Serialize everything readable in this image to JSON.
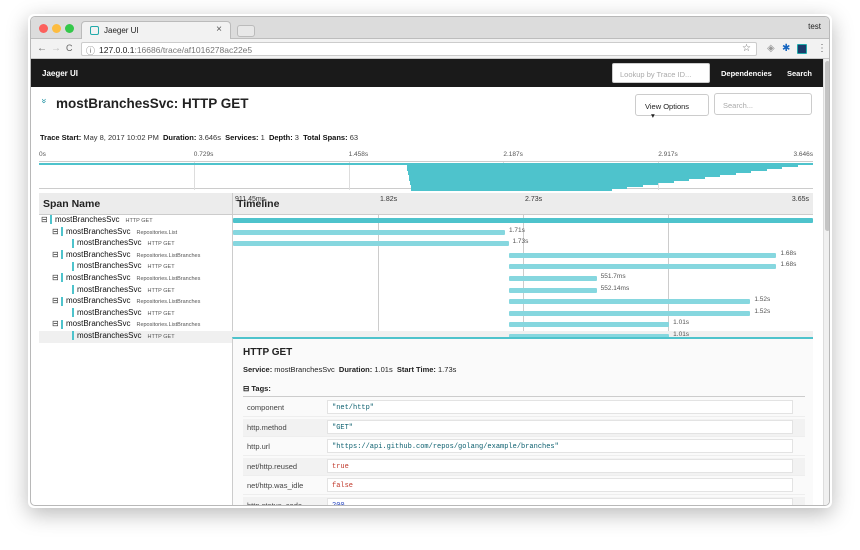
{
  "browser": {
    "tab_title": "Jaeger UI",
    "tab_close": "×",
    "profile": "test",
    "url_host": "127.0.0.1",
    "url_path": ":16686/trace/af1016278ac22e5",
    "nav_back": "←",
    "nav_forward": "→",
    "nav_reload": "C",
    "star": "☆",
    "info": "ⓘ",
    "menu": "⋮"
  },
  "app": {
    "brand": "Jaeger UI",
    "lookup_placeholder": "Lookup by Trace ID...",
    "nav": [
      "Dependencies",
      "Search"
    ]
  },
  "trace": {
    "chevron": "»",
    "title": "mostBranchesSvc: HTTP GET",
    "view_options": "View Options",
    "view_options_caret": "▾",
    "find_placeholder": "Search...",
    "summary": {
      "trace_start_label": "Trace Start:",
      "trace_start": "May 8, 2017 10:02 PM",
      "duration_label": "Duration:",
      "duration": "3.646s",
      "services_label": "Services:",
      "services": "1",
      "depth_label": "Depth:",
      "depth": "3",
      "total_spans_label": "Total Spans:",
      "total_spans": "63"
    },
    "minimap_ticks": [
      "0s",
      "0.729s",
      "1.458s",
      "2.187s",
      "2.917s",
      "3.646s"
    ],
    "header": {
      "span_name": "Span Name",
      "timeline": "Timeline",
      "ticks": [
        "911.45ms",
        "1.82s",
        "2.73s",
        "3.65s"
      ]
    },
    "spans": [
      {
        "toggle": "⊟",
        "service": "mostBranchesSvc",
        "operation": "HTTP GET",
        "depth": 0,
        "start": 0.0,
        "end": 1.0,
        "label": ""
      },
      {
        "toggle": "⊟",
        "service": "mostBranchesSvc",
        "operation": "Repositories.List",
        "depth": 1,
        "start": 0.0,
        "end": 0.469,
        "label": "1.71s"
      },
      {
        "toggle": "",
        "service": "mostBranchesSvc",
        "operation": "HTTP GET",
        "depth": 2,
        "start": 0.0,
        "end": 0.475,
        "label": "1.73s"
      },
      {
        "toggle": "⊟",
        "service": "mostBranchesSvc",
        "operation": "Repositories.ListBranches",
        "depth": 1,
        "start": 0.475,
        "end": 0.937,
        "label": "1.68s"
      },
      {
        "toggle": "",
        "service": "mostBranchesSvc",
        "operation": "HTTP GET",
        "depth": 2,
        "start": 0.475,
        "end": 0.937,
        "label": "1.68s"
      },
      {
        "toggle": "⊟",
        "service": "mostBranchesSvc",
        "operation": "Repositories.ListBranches",
        "depth": 1,
        "start": 0.475,
        "end": 0.627,
        "label": "551.7ms"
      },
      {
        "toggle": "",
        "service": "mostBranchesSvc",
        "operation": "HTTP GET",
        "depth": 2,
        "start": 0.475,
        "end": 0.627,
        "label": "552.14ms"
      },
      {
        "toggle": "⊟",
        "service": "mostBranchesSvc",
        "operation": "Repositories.ListBranches",
        "depth": 1,
        "start": 0.475,
        "end": 0.892,
        "label": "1.52s"
      },
      {
        "toggle": "",
        "service": "mostBranchesSvc",
        "operation": "HTTP GET",
        "depth": 2,
        "start": 0.475,
        "end": 0.892,
        "label": "1.52s"
      },
      {
        "toggle": "⊟",
        "service": "mostBranchesSvc",
        "operation": "Repositories.ListBranches",
        "depth": 1,
        "start": 0.475,
        "end": 0.752,
        "label": "1.01s"
      },
      {
        "toggle": "",
        "service": "mostBranchesSvc",
        "operation": "HTTP GET",
        "depth": 2,
        "start": 0.475,
        "end": 0.752,
        "label": "1.01s",
        "selected": true
      }
    ]
  },
  "detail": {
    "title": "HTTP GET",
    "service_label": "Service:",
    "service": "mostBranchesSvc",
    "duration_label": "Duration:",
    "duration": "1.01s",
    "start_label": "Start Time:",
    "start": "1.73s",
    "tags_toggle": "⊟",
    "tags_label": "Tags:",
    "tags": [
      {
        "key": "component",
        "value": "\"net/http\"",
        "color": "#0b5f6e"
      },
      {
        "key": "http.method",
        "value": "\"GET\"",
        "color": "#0b5f6e"
      },
      {
        "key": "http.url",
        "value": "\"https://api.github.com/repos/golang/example/branches\"",
        "color": "#0b5f6e"
      },
      {
        "key": "net/http.reused",
        "value": "true",
        "color": "#c0392b"
      },
      {
        "key": "net/http.was_idle",
        "value": "false",
        "color": "#c0392b"
      },
      {
        "key": "http.status_code",
        "value": "200",
        "color": "#1f3fbf"
      }
    ]
  },
  "colors": {
    "accent": "#4ec3cc",
    "bar": "#86d7df",
    "nav": "#1a1a1a"
  }
}
